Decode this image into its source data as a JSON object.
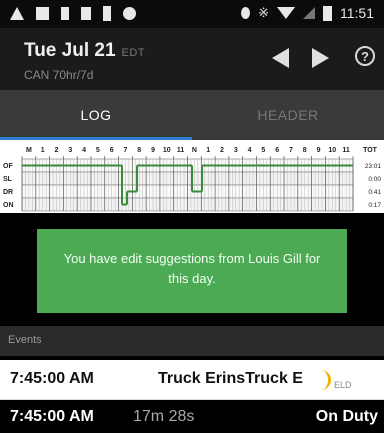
{
  "status_bar": {
    "left_icons": [
      "warning-icon",
      "image-icon",
      "download-icon",
      "sd-card-icon",
      "phone-icon",
      "recording-icon"
    ],
    "right_icons": [
      "location-icon",
      "bluetooth-icon",
      "wifi-icon",
      "signal-icon",
      "battery-icon"
    ],
    "time": "11:51"
  },
  "app_bar": {
    "date": "Tue Jul 21",
    "timezone": "EDT",
    "cycle": "CAN 70hr/7d",
    "prev_icon": "chevron-left-icon",
    "next_icon": "chevron-right-icon",
    "help_icon": "help-icon",
    "help_glyph": "?"
  },
  "tabs": [
    {
      "label": "LOG",
      "active": true
    },
    {
      "label": "HEADER",
      "active": false
    }
  ],
  "log_grid": {
    "hour_labels": [
      "M",
      "1",
      "2",
      "3",
      "4",
      "5",
      "6",
      "7",
      "8",
      "9",
      "10",
      "11",
      "N",
      "1",
      "2",
      "3",
      "4",
      "5",
      "6",
      "7",
      "8",
      "9",
      "10",
      "11"
    ],
    "total_label": "TOT",
    "rows": [
      {
        "label": "OF",
        "total": "23:01"
      },
      {
        "label": "SL",
        "total": "0:00"
      },
      {
        "label": "DR",
        "total": "0:41"
      },
      {
        "label": "ON",
        "total": "0:17"
      }
    ],
    "line_color": "#3a8a3a"
  },
  "message": {
    "text": "You have edit suggestions from Louis Gill for this day.",
    "bg": "#4caa55"
  },
  "events": {
    "title": "Events",
    "rows": [
      {
        "time": "7:45:00 AM",
        "vehicle": "Truck ErinsTruck E",
        "eld_label": "ELD"
      },
      {
        "time": "7:45:00 AM",
        "duration": "17m 28s",
        "status": "On Duty"
      }
    ]
  }
}
